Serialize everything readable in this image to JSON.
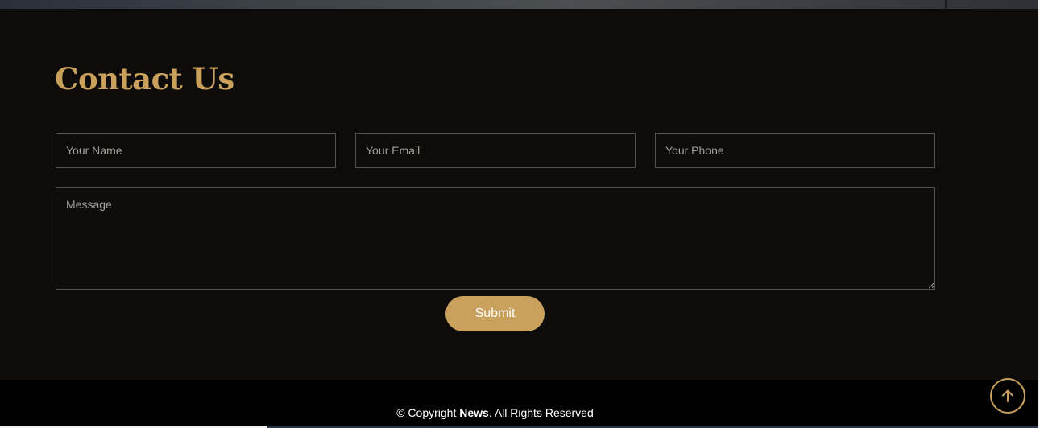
{
  "contact": {
    "title": "Contact Us",
    "name_placeholder": "Your Name",
    "email_placeholder": "Your Email",
    "phone_placeholder": "Your Phone",
    "message_placeholder": "Message",
    "submit_label": "Submit"
  },
  "footer": {
    "copyright_prefix": "© Copyright ",
    "brand": "News",
    "copyright_suffix": ". All Rights Reserved"
  },
  "icons": {
    "back_to_top": "arrow-up-icon"
  },
  "colors": {
    "accent": "#c9a15c",
    "section_bg": "#0d0c0b",
    "footer_bg": "#000000"
  }
}
